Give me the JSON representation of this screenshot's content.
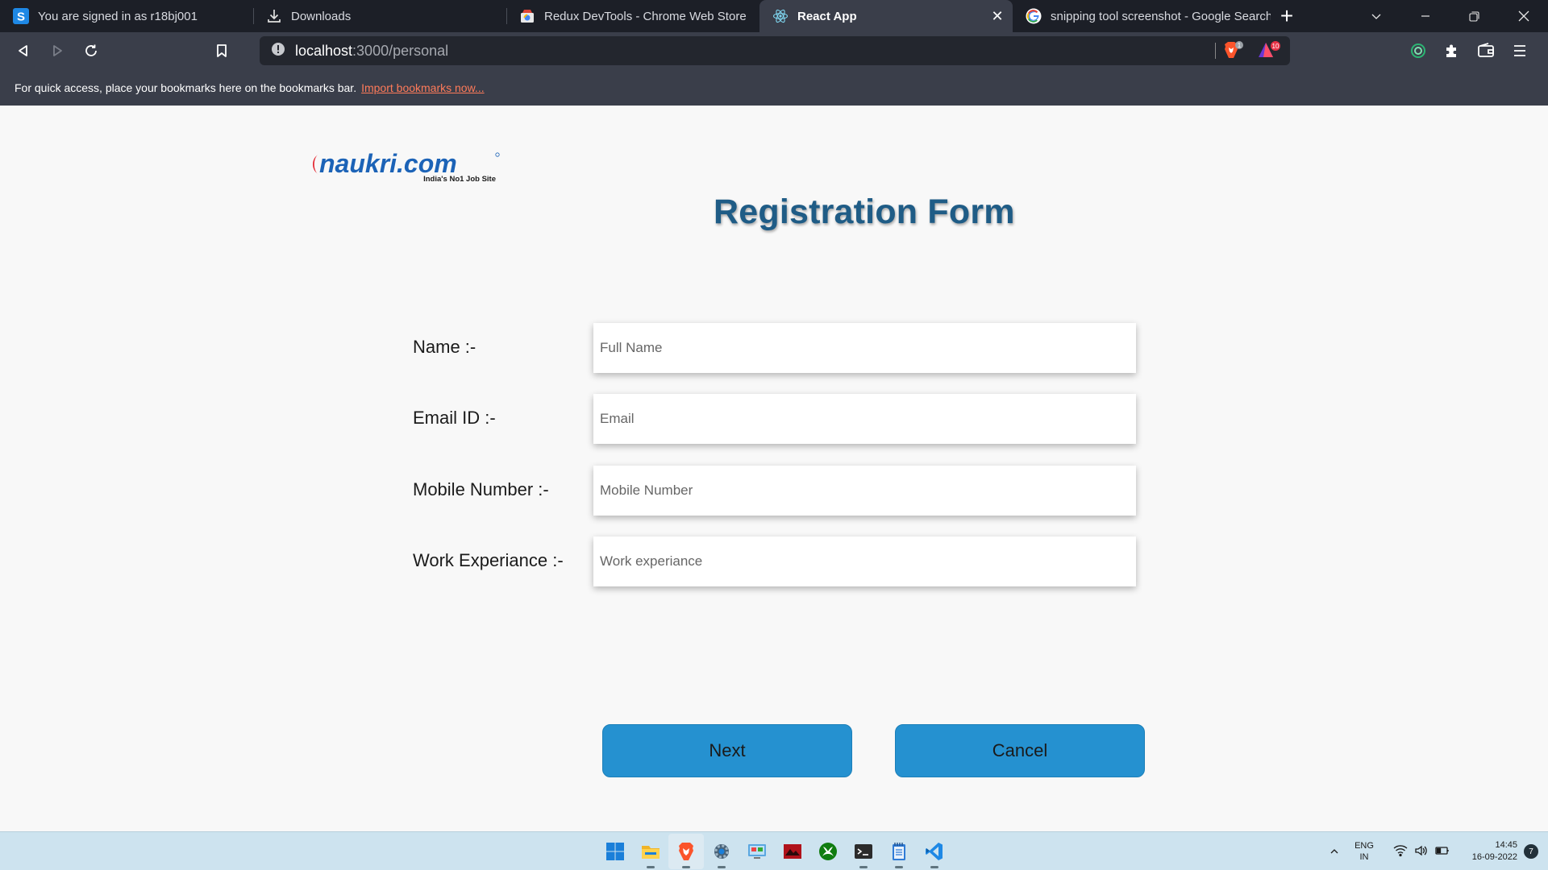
{
  "browser": {
    "tabs": [
      {
        "title": "You are signed in as r18bj001",
        "icon": "s-app-icon"
      },
      {
        "title": "Downloads",
        "icon": "download-icon"
      },
      {
        "title": "Redux DevTools - Chrome Web Store",
        "icon": "web-store-icon"
      },
      {
        "title": "React App",
        "icon": "react-icon",
        "active": true
      },
      {
        "title": "snipping tool screenshot - Google Search",
        "icon": "google-icon"
      }
    ],
    "url": {
      "host": "localhost",
      "path": ":3000/personal"
    },
    "shield_count": "1",
    "rewards_count": "10",
    "bookmarks_text": "For quick access, place your bookmarks here on the bookmarks bar.",
    "bookmarks_link": "Import bookmarks now..."
  },
  "page": {
    "logo": {
      "wordmark": "naukri.com",
      "tagline": "India's No1 Job Site"
    },
    "title": "Registration Form",
    "fields": [
      {
        "label": "Name :-",
        "placeholder": "Full Name"
      },
      {
        "label": "Email ID :-",
        "placeholder": "Email"
      },
      {
        "label": "Mobile Number :-",
        "placeholder": "Mobile Number"
      },
      {
        "label": "Work Experiance :-",
        "placeholder": "Work experiance"
      }
    ],
    "buttons": {
      "next": "Next",
      "cancel": "Cancel"
    },
    "colors": {
      "title": "#1f5c86",
      "button": "#2591d0",
      "logo_blue": "#1c63b7",
      "logo_red": "#e3202a"
    }
  },
  "taskbar": {
    "apps": [
      "windows-start-icon",
      "file-explorer-icon",
      "brave-browser-icon",
      "settings-icon",
      "control-panel-icon",
      "red-app-icon",
      "xbox-icon",
      "terminal-icon",
      "notepad-icon",
      "vscode-icon"
    ],
    "lang_top": "ENG",
    "lang_bottom": "IN",
    "time": "14:45",
    "date": "16-09-2022",
    "notifications": "7"
  }
}
